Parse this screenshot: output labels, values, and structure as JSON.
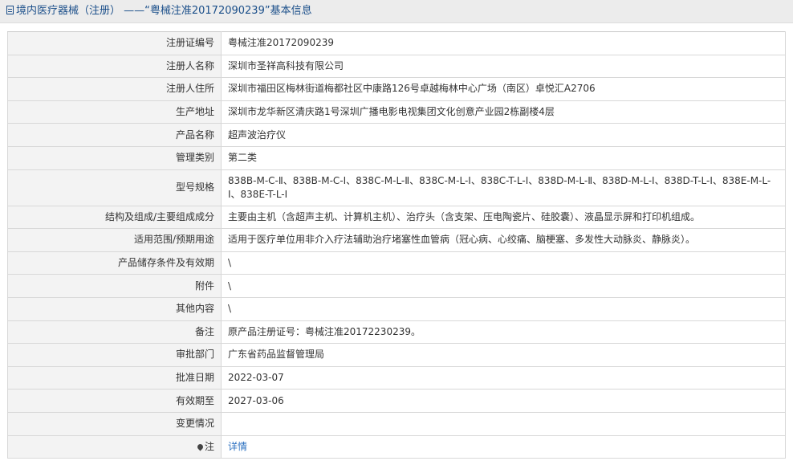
{
  "header": {
    "title": "境内医疗器械（注册） ——“粤械注准20172090239”基本信息"
  },
  "rows": [
    {
      "label": "注册证编号",
      "value": "粤械注准20172090239"
    },
    {
      "label": "注册人名称",
      "value": "深圳市圣祥高科技有限公司"
    },
    {
      "label": "注册人住所",
      "value": "深圳市福田区梅林街道梅都社区中康路126号卓越梅林中心广场（南区）卓悦汇A2706"
    },
    {
      "label": "生产地址",
      "value": "深圳市龙华新区清庆路1号深圳广播电影电视集团文化创意产业园2栋副楼4层"
    },
    {
      "label": "产品名称",
      "value": "超声波治疗仪"
    },
    {
      "label": "管理类别",
      "value": "第二类"
    },
    {
      "label": "型号规格",
      "value": "838B-M-C-Ⅱ、838B-M-C-Ⅰ、838C-M-L-Ⅱ、838C-M-L-Ⅰ、838C-T-L-Ⅰ、838D-M-L-Ⅱ、838D-M-L-Ⅰ、838D-T-L-Ⅰ、838E-M-L-Ⅰ、838E-T-L-Ⅰ"
    },
    {
      "label": "结构及组成/主要组成成分",
      "value": "主要由主机（含超声主机、计算机主机）、治疗头（含支架、压电陶瓷片、硅胶囊）、液晶显示屏和打印机组成。"
    },
    {
      "label": "适用范围/预期用途",
      "value": "适用于医疗单位用非介入疗法辅助治疗堵塞性血管病（冠心病、心绞痛、脑梗塞、多发性大动脉炎、静脉炎）。"
    },
    {
      "label": "产品储存条件及有效期",
      "value": "\\"
    },
    {
      "label": "附件",
      "value": "\\"
    },
    {
      "label": "其他内容",
      "value": "\\"
    },
    {
      "label": "备注",
      "value": "原产品注册证号：粤械注准20172230239。"
    },
    {
      "label": "审批部门",
      "value": "广东省药品监督管理局"
    },
    {
      "label": "批准日期",
      "value": "2022-03-07"
    },
    {
      "label": "有效期至",
      "value": "2027-03-06"
    },
    {
      "label": "变更情况",
      "value": ""
    }
  ],
  "note": {
    "label": "注",
    "link": "详情",
    "icon": "pin-icon"
  },
  "colors": {
    "title": "#1b4f8a",
    "label_bg": "#f3f3f3",
    "border": "#d8d8d8",
    "link": "#2a6fc0"
  }
}
